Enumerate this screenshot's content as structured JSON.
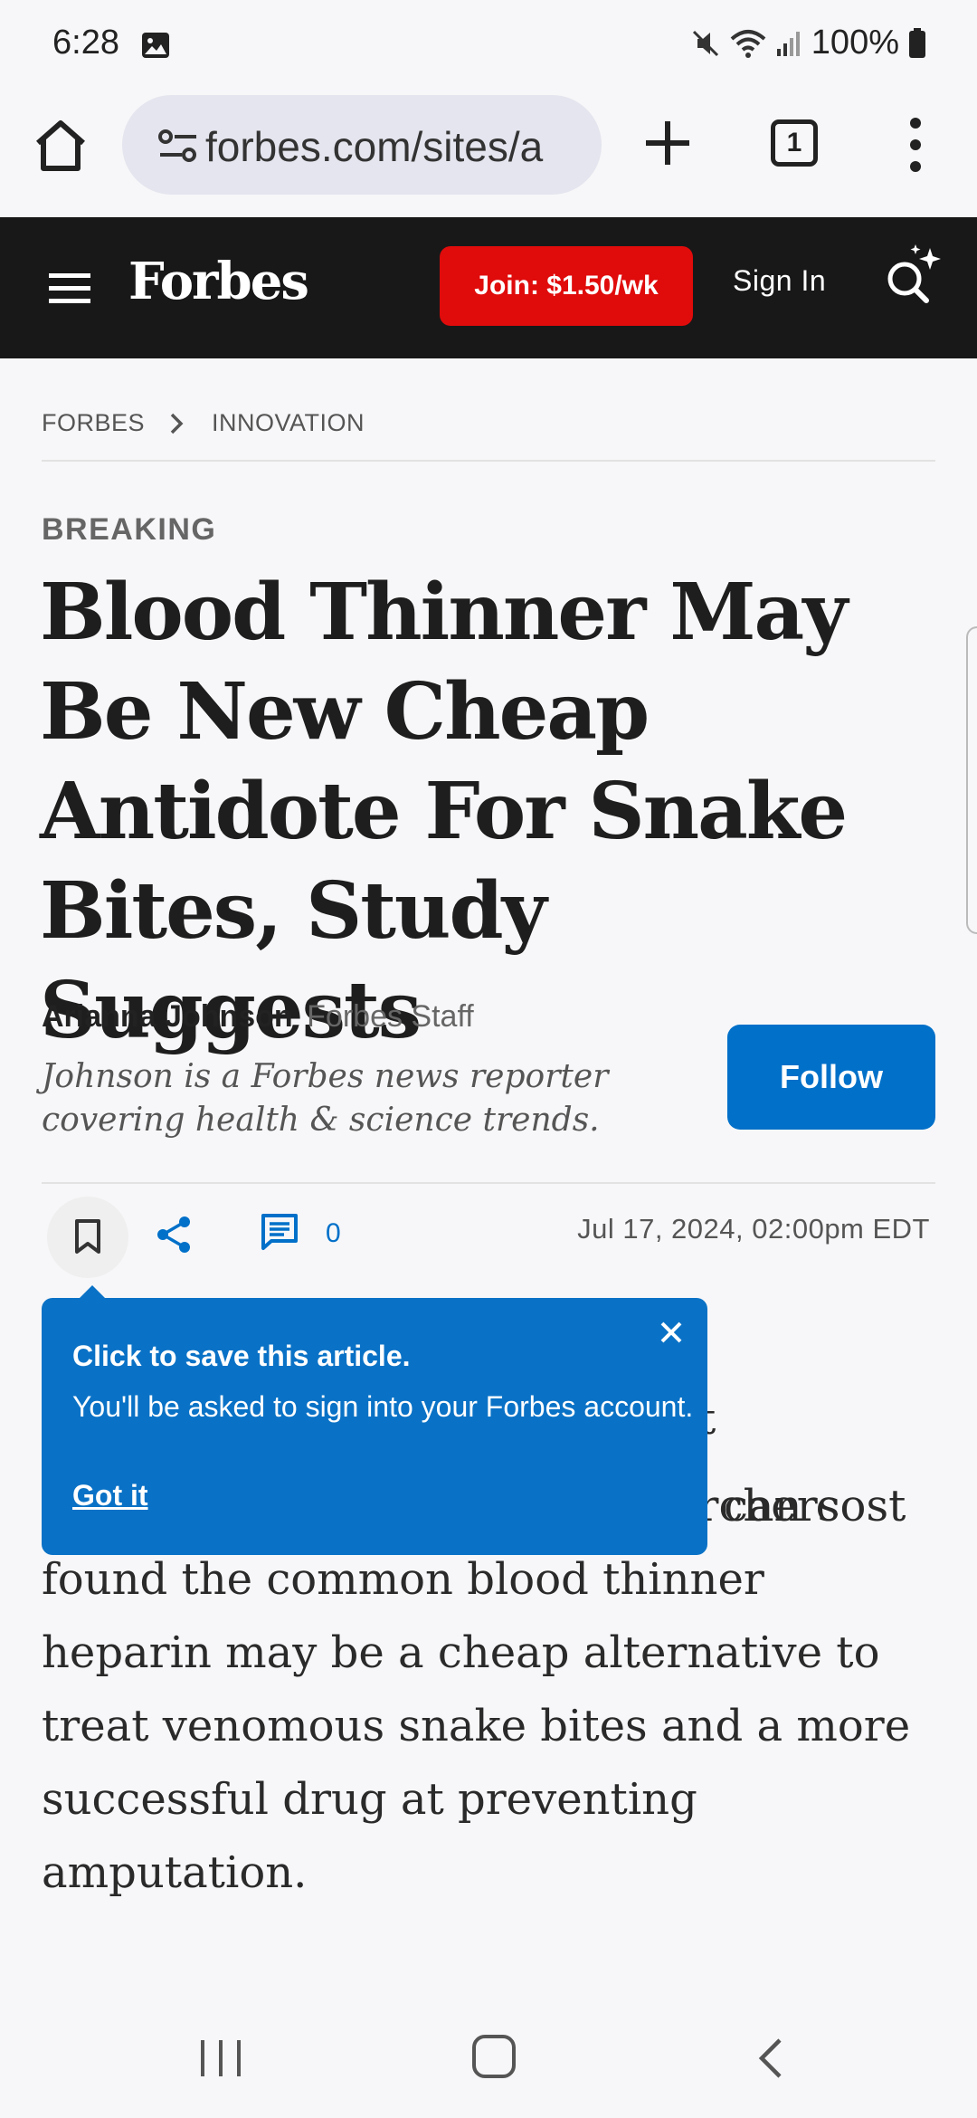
{
  "status_bar": {
    "time": "6:28",
    "battery": "100%"
  },
  "browser": {
    "url": "forbes.com/sites/a",
    "tab_count": "1"
  },
  "header": {
    "logo": "Forbes",
    "join_label": "Join: $1.50/wk",
    "signin_label": "Sign In"
  },
  "breadcrumb": {
    "items": [
      "FORBES",
      "INNOVATION"
    ]
  },
  "article": {
    "kicker": "BREAKING",
    "headline": "Blood Thinner May Be New Cheap Antidote For Snake Bites, Study Suggests",
    "author_name": "Arianna Johnson",
    "author_role": "Forbes Staff",
    "author_bio": "Johnson is a Forbes news reporter covering health & science trends.",
    "follow_label": "Follow",
    "comment_count": "0",
    "date": "Jul 17, 2024, 02:00pm EDT",
    "body_fragment_1": "t",
    "body_fragment_2": "can cost",
    "body_lines": [
      "thousands of dollars, so researchers",
      "found the common blood thinner",
      "heparin may be a cheap alternative to",
      "treat venomous snake bites and a more",
      "successful drug at preventing",
      "amputation."
    ]
  },
  "tooltip": {
    "title": "Click to save this article.",
    "text": "You'll be asked to sign into your Forbes account.",
    "link": "Got it"
  },
  "colors": {
    "forbes_red": "#e00b0b",
    "forbes_blue": "#0070c9",
    "header_bg": "#181818"
  },
  "icons": [
    "home-icon",
    "tune-icon",
    "plus-icon",
    "tabs-icon",
    "more-vert-icon",
    "hamburger-icon",
    "search-sparkle-icon",
    "bookmark-icon",
    "share-icon",
    "comment-icon",
    "close-icon",
    "recents-icon",
    "nav-home-icon",
    "back-icon"
  ]
}
